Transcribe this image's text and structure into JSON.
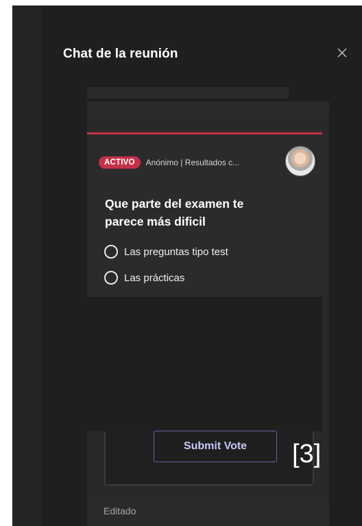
{
  "panel": {
    "title": "Chat de la reunión",
    "close_icon": "close-icon"
  },
  "poll": {
    "status_badge": "ACTIVO",
    "meta": "Anónimo | Resultados c...",
    "question": "Que parte del examen te parece más dificil",
    "options": [
      {
        "label": "Las preguntas tipo test"
      },
      {
        "label": "Las prácticas"
      }
    ],
    "submit_label": "Submit Vote",
    "accent_color": "#c4314b",
    "button_color": "#6264a7"
  },
  "annotation": "[3]",
  "footer": {
    "edited_label": "Editado"
  }
}
